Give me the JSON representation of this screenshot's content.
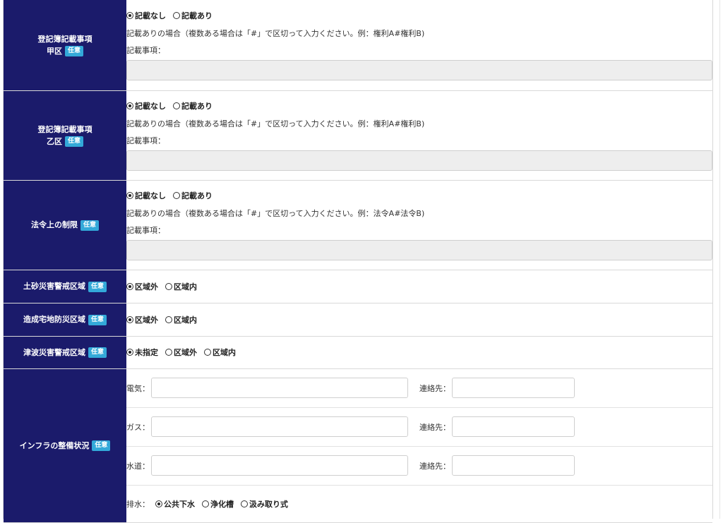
{
  "rows": {
    "kouku": {
      "label_line1": "登記簿記載事項",
      "label_line2": "甲区",
      "badge": "任意",
      "options": [
        "記載なし",
        "記載あり"
      ],
      "selected": 0,
      "note": "記載ありの場合（複数ある場合は「#」で区切って入力ください。例：権利A#権利B)",
      "field_label": "記載事項：",
      "field_value": ""
    },
    "otsuku": {
      "label_line1": "登記簿記載事項",
      "label_line2": "乙区",
      "badge": "任意",
      "options": [
        "記載なし",
        "記載あり"
      ],
      "selected": 0,
      "note": "記載ありの場合（複数ある場合は「#」で区切って入力ください。例：権利A#権利B)",
      "field_label": "記載事項：",
      "field_value": ""
    },
    "hourei": {
      "label": "法令上の制限",
      "badge": "任意",
      "options": [
        "記載なし",
        "記載あり"
      ],
      "selected": 0,
      "note": "記載ありの場合（複数ある場合は「#」で区切って入力ください。例：法令A#法令B)",
      "field_label": "記載事項：",
      "field_value": ""
    },
    "dosha": {
      "label": "土砂災害警戒区域",
      "badge": "任意",
      "options": [
        "区域外",
        "区域内"
      ],
      "selected": 0
    },
    "zousei": {
      "label": "造成宅地防災区域",
      "badge": "任意",
      "options": [
        "区域外",
        "区域内"
      ],
      "selected": 0
    },
    "tsunami": {
      "label": "津波災害警戒区域",
      "badge": "任意",
      "options": [
        "未指定",
        "区域外",
        "区域内"
      ],
      "selected": 0
    },
    "infra": {
      "label": "インフラの整備状況",
      "badge": "任意",
      "denki_label": "電気：",
      "gas_label": "ガス：",
      "suidou_label": "水道：",
      "contact_label": "連絡先：",
      "denki_value": "",
      "gas_value": "",
      "suidou_value": "",
      "denki_contact": "",
      "gas_contact": "",
      "suidou_contact": "",
      "drain_label": "排水：",
      "drain_options": [
        "公共下水",
        "浄化槽",
        "汲み取り式"
      ],
      "drain_selected": 0
    }
  }
}
